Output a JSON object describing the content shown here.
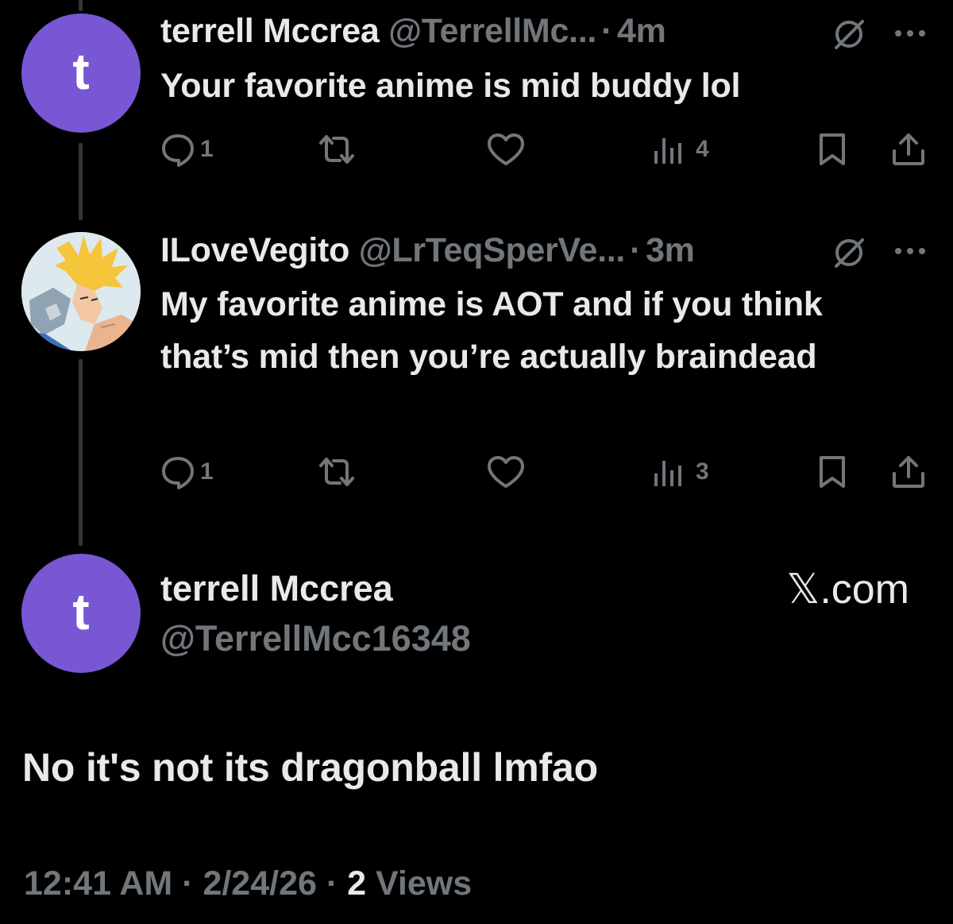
{
  "colors": {
    "background": "#000000",
    "text_primary": "#e7e9ea",
    "text_secondary": "#71767b",
    "avatar_purple": "#7856d4",
    "thread_line": "#333639"
  },
  "tweets": [
    {
      "avatar_letter": "t",
      "display_name": "terrell Mccrea",
      "handle": "@TerrellMc...",
      "separator": "·",
      "time": "4m",
      "text": "Your favorite anime is mid buddy lol",
      "replies": "1",
      "views": "4",
      "icons": [
        "grok-icon",
        "more-icon",
        "reply-icon",
        "retweet-icon",
        "like-icon",
        "views-icon",
        "bookmark-icon",
        "share-icon"
      ]
    },
    {
      "avatar_letter": "",
      "display_name": "ILoveVegito",
      "handle": "@LrTeqSperVe...",
      "separator": "·",
      "time": "3m",
      "text": "My favorite anime is AOT and if you think that’s mid then you’re actually braindead",
      "replies": "1",
      "views": "3",
      "icons": [
        "grok-icon",
        "more-icon",
        "reply-icon",
        "retweet-icon",
        "like-icon",
        "views-icon",
        "bookmark-icon",
        "share-icon"
      ]
    }
  ],
  "main_tweet": {
    "avatar_letter": "t",
    "display_name": "terrell Mccrea",
    "handle": "@TerrellMcc16348",
    "brand": "𝕏.com",
    "text": "No it's not its dragonball lmfao",
    "time": "12:41 AM",
    "separator": "·",
    "date": "2/24/26",
    "views_count": "2",
    "views_label": "Views"
  }
}
